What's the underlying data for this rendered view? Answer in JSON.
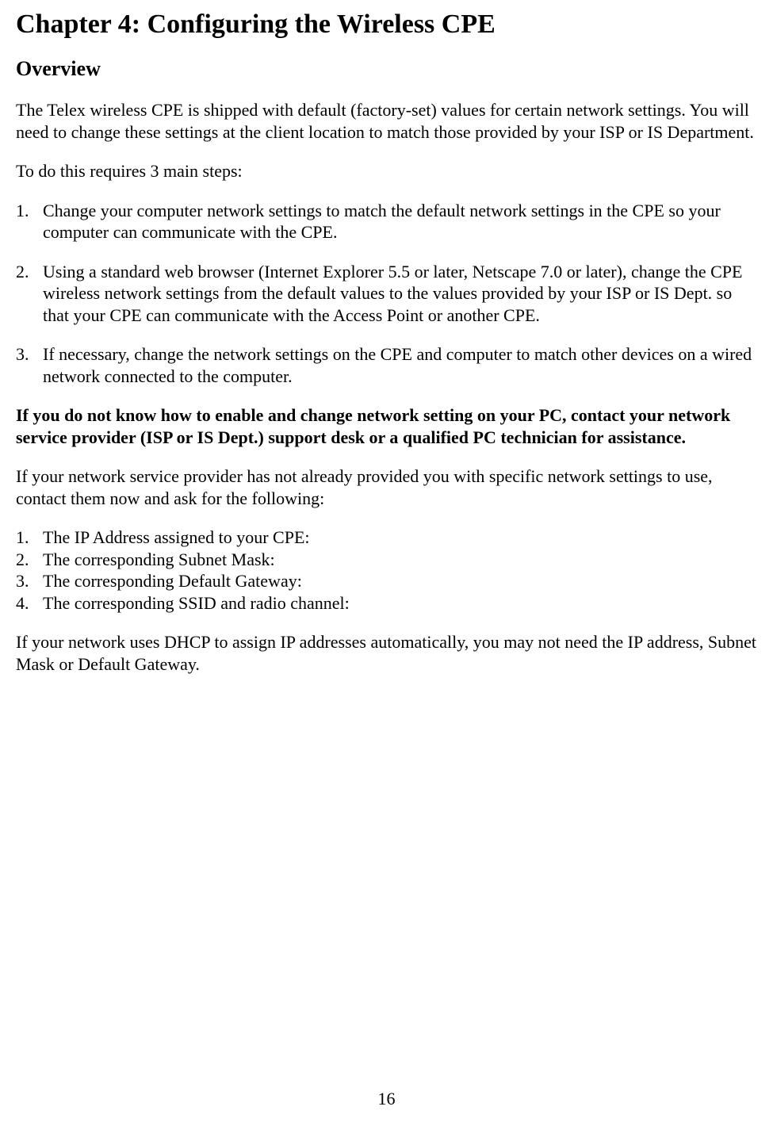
{
  "chapterTitle": "Chapter 4: Configuring the Wireless CPE",
  "sectionHeading": "Overview",
  "intro": "The Telex wireless CPE is shipped with default (factory-set) values for certain network settings. You will need to change these settings at the client location to match those provided by your ISP or IS Department.",
  "stepsIntro": "To do this requires 3 main steps:",
  "steps": [
    "Change your computer network settings to match the default network settings in the CPE so your computer can communicate with the CPE.",
    "Using a standard web browser (Internet Explorer 5.5 or later, Netscape 7.0 or later), change the CPE wireless network settings from the default values to the values provided by your ISP or IS Dept. so that your CPE can communicate with the Access Point or another CPE.",
    "If necessary, change the network settings on the CPE and computer to match other devices on a wired network connected to the computer."
  ],
  "warning": "If you do not know how to enable and change network setting on your PC, contact your network service provider (ISP or IS Dept.) support desk or a qualified PC technician for assistance.",
  "askFor": "If your network service provider has not already provided you with specific network settings to use, contact them now and ask for the following:",
  "askList": [
    "The IP Address assigned to your CPE:",
    "The corresponding Subnet Mask:",
    "The corresponding Default Gateway:",
    "The corresponding SSID and radio channel:"
  ],
  "dhcpNote": "If your network uses DHCP to assign IP addresses automatically, you may not need the IP address, Subnet Mask or Default Gateway.",
  "pageNumber": "16"
}
